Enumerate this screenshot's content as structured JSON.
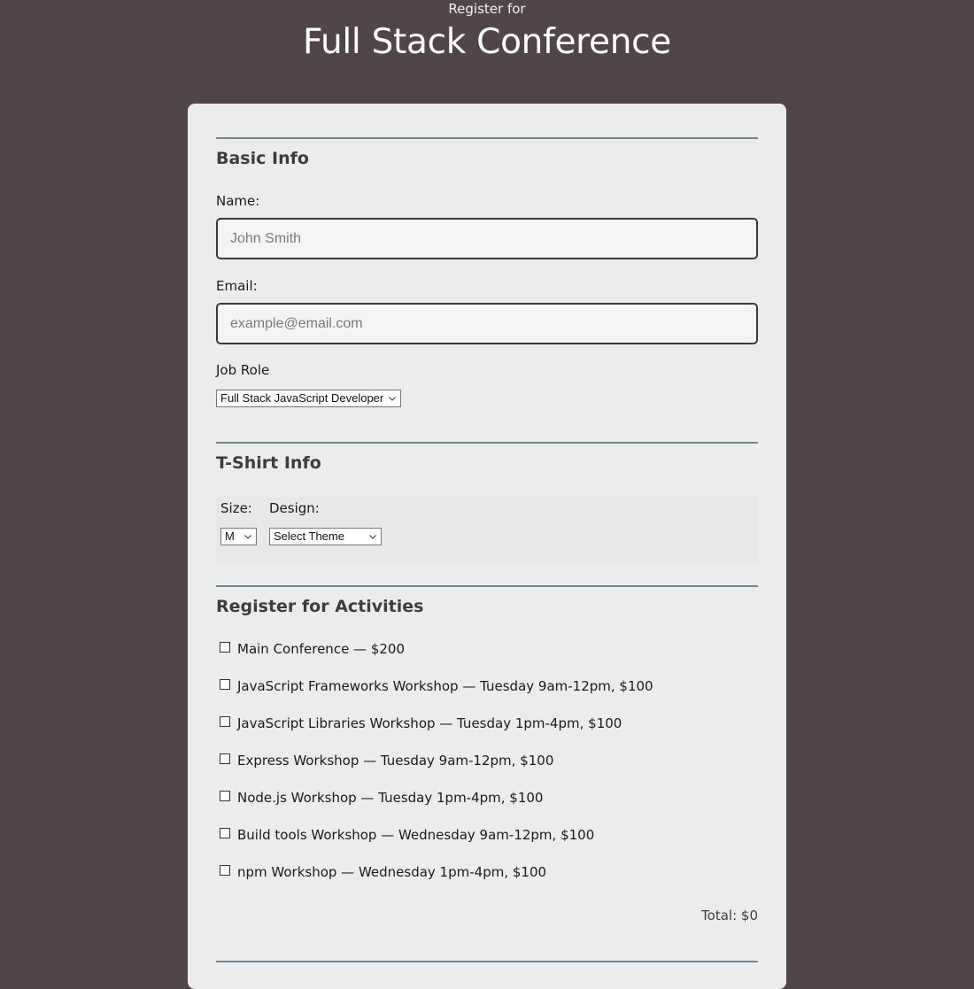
{
  "header": {
    "subtitle": "Register for",
    "title": "Full Stack Conference"
  },
  "basic_info": {
    "heading": "Basic Info",
    "name_label": "Name:",
    "name_placeholder": "John Smith",
    "name_value": "",
    "email_label": "Email:",
    "email_placeholder": "example@email.com",
    "email_value": "",
    "job_role_label": "Job Role",
    "job_role_selected": "Full Stack JavaScript Developer"
  },
  "tshirt": {
    "heading": "T-Shirt Info",
    "size_label": "Size:",
    "size_selected": "M",
    "design_label": "Design:",
    "design_selected": "Select Theme"
  },
  "activities": {
    "heading": "Register for Activities",
    "items": [
      {
        "label": "Main Conference — $200",
        "checked": false
      },
      {
        "label": "JavaScript Frameworks Workshop — Tuesday 9am-12pm, $100",
        "checked": false
      },
      {
        "label": "JavaScript Libraries Workshop — Tuesday 1pm-4pm, $100",
        "checked": false
      },
      {
        "label": "Express Workshop — Tuesday 9am-12pm, $100",
        "checked": false
      },
      {
        "label": "Node.js Workshop — Tuesday 1pm-4pm, $100",
        "checked": false
      },
      {
        "label": "Build tools Workshop — Wednesday 9am-12pm, $100",
        "checked": false
      },
      {
        "label": "npm Workshop — Wednesday 1pm-4pm, $100",
        "checked": false
      }
    ],
    "total": "Total: $0"
  },
  "icons": {
    "select_arrow": "chevron-down-icon"
  },
  "colors": {
    "page_background": "#514549",
    "card_background": "#ececec",
    "section_rule": "#6c8793"
  }
}
